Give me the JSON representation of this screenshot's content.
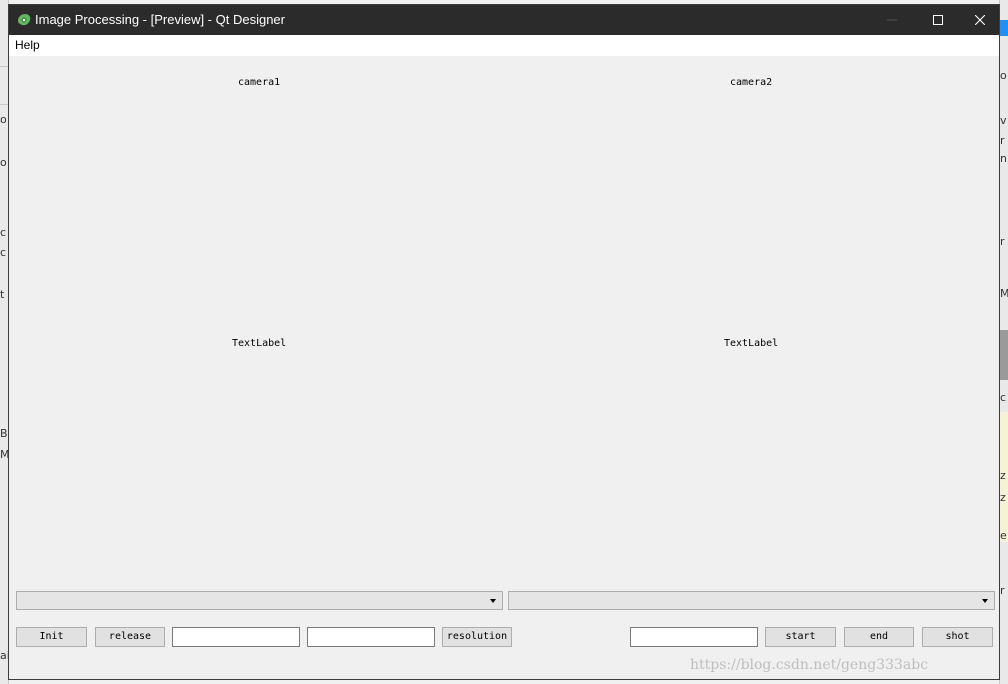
{
  "window": {
    "title": "Image Processing - [Preview] - Qt Designer",
    "titlebar_color": "#2b2b2b",
    "buttons": {
      "minimize": "minimize-icon",
      "maximize": "maximize-icon",
      "close": "close-icon"
    }
  },
  "menubar": {
    "items": [
      "Help"
    ]
  },
  "cameras": {
    "left": {
      "title": "camera1",
      "image_label": "TextLabel",
      "combo_value": ""
    },
    "right": {
      "title": "camera2",
      "image_label": "TextLabel",
      "combo_value": ""
    }
  },
  "controls": {
    "init_label": "Init",
    "release_label": "release",
    "field1_value": "",
    "field2_value": "",
    "resolution_label": "resolution",
    "field3_value": "",
    "start_label": "start",
    "end_label": "end",
    "shot_label": "shot"
  },
  "watermark": "https://blog.csdn.net/geng333abc",
  "background_fragments": {
    "left": [
      "o",
      "o",
      "c",
      "c",
      "t",
      "B",
      "M",
      "ai"
    ],
    "right": [
      "o",
      "v",
      "r",
      "n",
      "r",
      "M",
      "c",
      "c",
      "z",
      "z",
      "e",
      "r"
    ]
  }
}
